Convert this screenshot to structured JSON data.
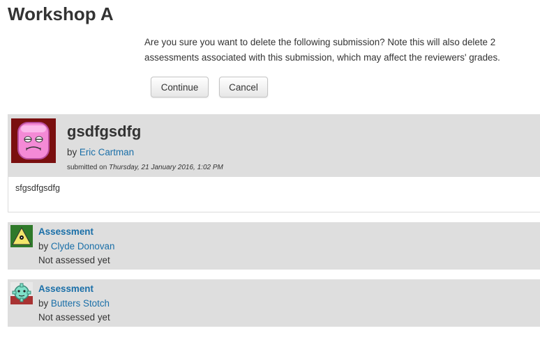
{
  "page": {
    "title": "Workshop A"
  },
  "confirm": {
    "message": "Are you sure you want to delete the following submission? Note this will also delete 2 assessments associated with this submission, which may affect the reviewers' grades.",
    "continue_label": "Continue",
    "cancel_label": "Cancel"
  },
  "submission": {
    "title": "gsdfgsdfg",
    "by_prefix": "by",
    "author": "Eric Cartman",
    "submitted_prefix": "submitted on",
    "submitted_date": "Thursday, 21 January 2016, 1:02 PM",
    "content": "sfgsdfgsdfg",
    "avatar_icon": "pink-character-avatar-icon"
  },
  "assessments": [
    {
      "title": "Assessment",
      "by_prefix": "by",
      "reviewer": "Clyde Donovan",
      "status": "Not assessed yet",
      "avatar_icon": "yellow-triangle-avatar-icon"
    },
    {
      "title": "Assessment",
      "by_prefix": "by",
      "reviewer": "Butters Stotch",
      "status": "Not assessed yet",
      "avatar_icon": "teal-gear-avatar-icon"
    }
  ],
  "colors": {
    "link": "#1a6fa8",
    "panel_bg": "#dedede",
    "avatar_main_bg": "#7a0f0f"
  }
}
